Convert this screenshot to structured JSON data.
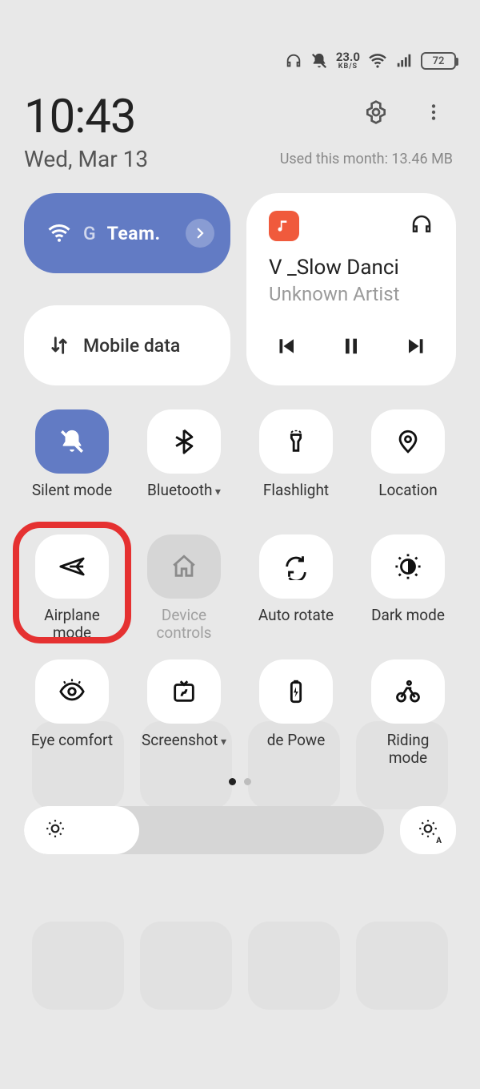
{
  "status": {
    "net_speed": "23.0",
    "net_unit": "KB/S",
    "battery": "72"
  },
  "header": {
    "time": "10:43",
    "date": "Wed, Mar 13",
    "data_usage": "Used this month: 13.46 MB"
  },
  "wifi_tile": {
    "prefix": "G",
    "label": "Team."
  },
  "mobile_tile": {
    "label": "Mobile data"
  },
  "media": {
    "title": "V _Slow Danci",
    "artist": "Unknown Artist"
  },
  "tiles": [
    {
      "label": "Silent mode",
      "icon": "bell-off",
      "state": "active"
    },
    {
      "label": "Bluetooth",
      "icon": "bluetooth",
      "state": "normal",
      "dropdown": true
    },
    {
      "label": "Flashlight",
      "icon": "flashlight",
      "state": "normal"
    },
    {
      "label": "Location",
      "icon": "pin",
      "state": "normal"
    },
    {
      "label": "Airplane\nmode",
      "icon": "airplane",
      "state": "normal",
      "highlight": true
    },
    {
      "label": "Device\ncontrols",
      "icon": "home",
      "state": "disabled"
    },
    {
      "label": "Auto rotate",
      "icon": "rotate",
      "state": "normal"
    },
    {
      "label": "Dark mode",
      "icon": "dark",
      "state": "normal"
    },
    {
      "label": "Eye comfort",
      "icon": "eye",
      "state": "normal"
    },
    {
      "label": "Screenshot",
      "icon": "screenshot",
      "state": "normal",
      "dropdown": true
    },
    {
      "label": "de    Powe",
      "icon": "battery",
      "state": "normal"
    },
    {
      "label": "Riding\nmode",
      "icon": "bike",
      "state": "normal"
    }
  ],
  "pager": {
    "current": 0,
    "count": 2
  }
}
